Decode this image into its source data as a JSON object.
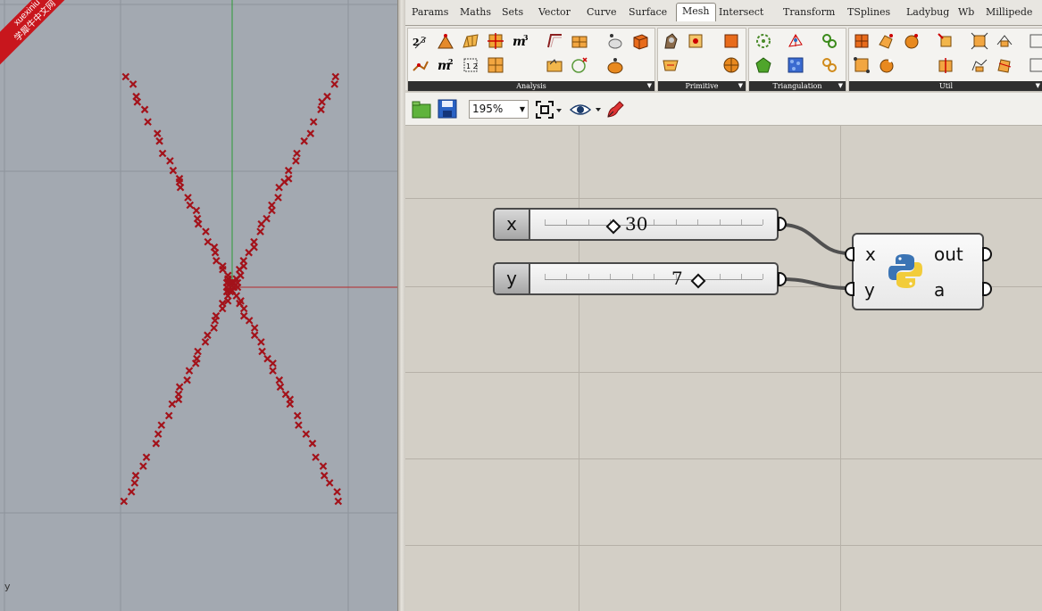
{
  "viewport": {
    "watermark": {
      "line1": "xuexiniu",
      "line2": "学犀牛中文网"
    },
    "axis_label": "y",
    "colors": {
      "background": "#a3a9b1",
      "grid": "#8e949c",
      "x_axis": "#b5292a",
      "y_axis": "#2e9a36",
      "points": "#a3121a"
    }
  },
  "grasshopper": {
    "tabs": [
      {
        "label": "Params"
      },
      {
        "label": "Maths"
      },
      {
        "label": "Sets"
      },
      {
        "label": "Vector"
      },
      {
        "label": "Curve"
      },
      {
        "label": "Surface"
      },
      {
        "label": "Mesh",
        "active": true
      },
      {
        "label": "Intersect"
      },
      {
        "label": "Transform"
      },
      {
        "label": "TSplines"
      },
      {
        "label": "Ladybug"
      },
      {
        "label": "Wb"
      },
      {
        "label": "Millipede"
      }
    ],
    "panels": [
      {
        "label": "Analysis"
      },
      {
        "label": "Primitive"
      },
      {
        "label": "Triangulation"
      },
      {
        "label": "Util"
      }
    ],
    "toolbar": {
      "zoom": "195%",
      "icons": [
        "open-file-icon",
        "save-icon",
        "zoom-extents-icon",
        "preview-eye-icon",
        "sketch-pen-icon"
      ]
    },
    "sliders": [
      {
        "name": "x",
        "value": "30",
        "position": 0.31
      },
      {
        "name": "y",
        "value": "7",
        "position": 0.7
      }
    ],
    "python_component": {
      "inputs": [
        "x",
        "y"
      ],
      "outputs": [
        "out",
        "a"
      ],
      "icon": "python-logo-icon"
    }
  }
}
